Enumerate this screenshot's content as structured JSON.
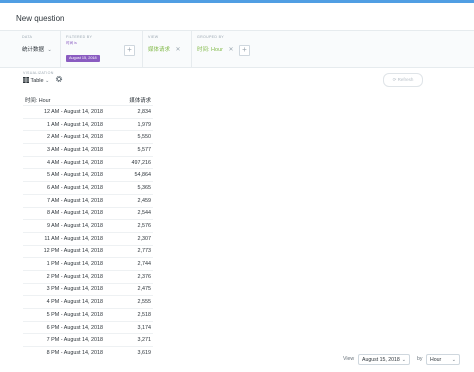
{
  "page": {
    "title": "New question"
  },
  "query_bar": {
    "data": {
      "label": "DATA",
      "value": "统计数据"
    },
    "filters": {
      "label": "FILTERED BY",
      "filter_top": "时间 is",
      "filter_pill": "August 15, 2018"
    },
    "view": {
      "label": "VIEW",
      "value": "媒体请求"
    },
    "group_by": {
      "label": "GROUPED BY",
      "value": "时间: Hour"
    }
  },
  "visualization": {
    "label": "VISUALIZATION",
    "type": "Table"
  },
  "refresh_label": "Refresh",
  "table": {
    "columns": [
      "时间: Hour",
      "媒体请求"
    ],
    "rows": [
      [
        "12 AM - August 14, 2018",
        "2,834"
      ],
      [
        "1 AM - August 14, 2018",
        "1,979"
      ],
      [
        "2 AM - August 14, 2018",
        "5,550"
      ],
      [
        "3 AM - August 14, 2018",
        "5,577"
      ],
      [
        "4 AM - August 14, 2018",
        "497,216"
      ],
      [
        "5 AM - August 14, 2018",
        "54,864"
      ],
      [
        "6 AM - August 14, 2018",
        "5,365"
      ],
      [
        "7 AM - August 14, 2018",
        "2,459"
      ],
      [
        "8 AM - August 14, 2018",
        "2,544"
      ],
      [
        "9 AM - August 14, 2018",
        "2,576"
      ],
      [
        "11 AM - August 14, 2018",
        "2,307"
      ],
      [
        "12 PM - August 14, 2018",
        "2,773"
      ],
      [
        "1 PM - August 14, 2018",
        "2,744"
      ],
      [
        "2 PM - August 14, 2018",
        "2,376"
      ],
      [
        "3 PM - August 14, 2018",
        "2,475"
      ],
      [
        "4 PM - August 14, 2018",
        "2,555"
      ],
      [
        "5 PM - August 14, 2018",
        "2,518"
      ],
      [
        "6 PM - August 14, 2018",
        "3,174"
      ],
      [
        "7 PM - August 14, 2018",
        "3,271"
      ],
      [
        "8 PM - August 14, 2018",
        "3,619"
      ]
    ]
  },
  "footer": {
    "view_label": "View",
    "date_value": "August 15, 2018",
    "by_label": "by",
    "unit_value": "Hour"
  },
  "colors": {
    "accent_blue": "#509ee3",
    "filter_purple": "#8a5cc1",
    "view_green": "#84bb4c",
    "text": "#2e353b"
  },
  "icons": [
    "table-icon",
    "gear-icon",
    "refresh-icon",
    "close-icon",
    "plus-icon",
    "chevron-down-icon"
  ]
}
